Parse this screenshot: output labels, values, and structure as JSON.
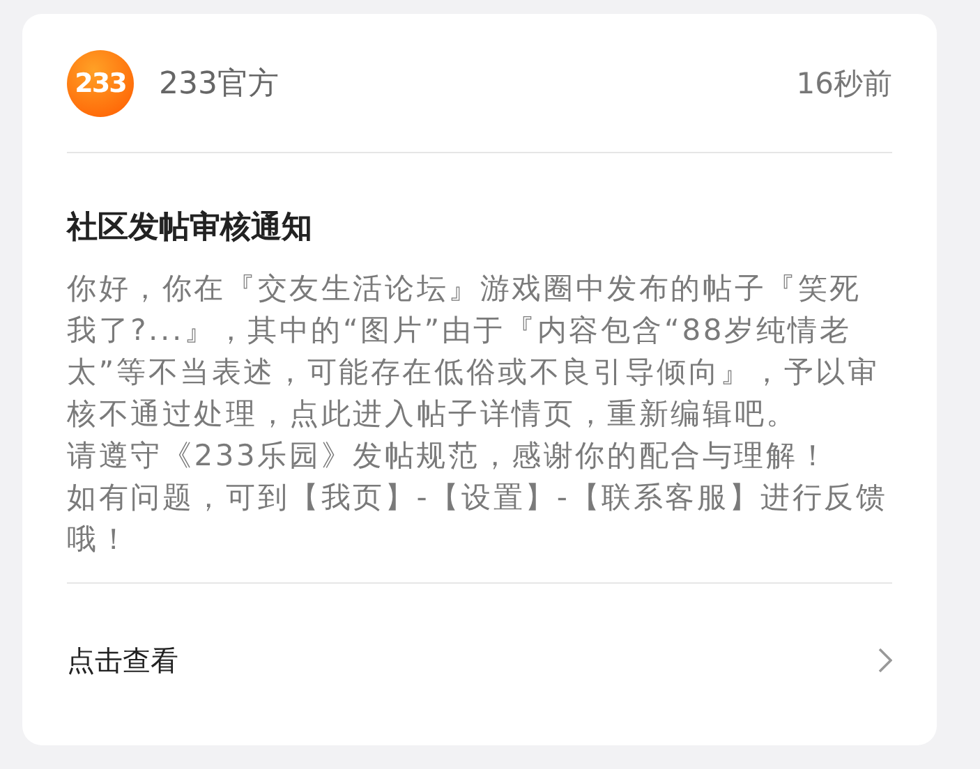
{
  "sender": {
    "logo_text": "233",
    "name": "233官方",
    "time": "16秒前"
  },
  "notice": {
    "title": "社区发帖审核通知",
    "paragraphs": [
      "你好，你在『交友生活论坛』游戏圈中发布的帖子『笑死我了?...』，其中的“图片”由于『内容包含“88岁纯情老太”等不当表述，可能存在低俗或不良引导倾向』，予以审核不通过处理，点此进入帖子详情页，重新编辑吧。",
      "请遵守《233乐园》发帖规范，感谢你的配合与理解！",
      "如有问题，可到【我页】-【设置】-【联系客服】进行反馈哦！"
    ]
  },
  "footer": {
    "label": "点击查看"
  }
}
